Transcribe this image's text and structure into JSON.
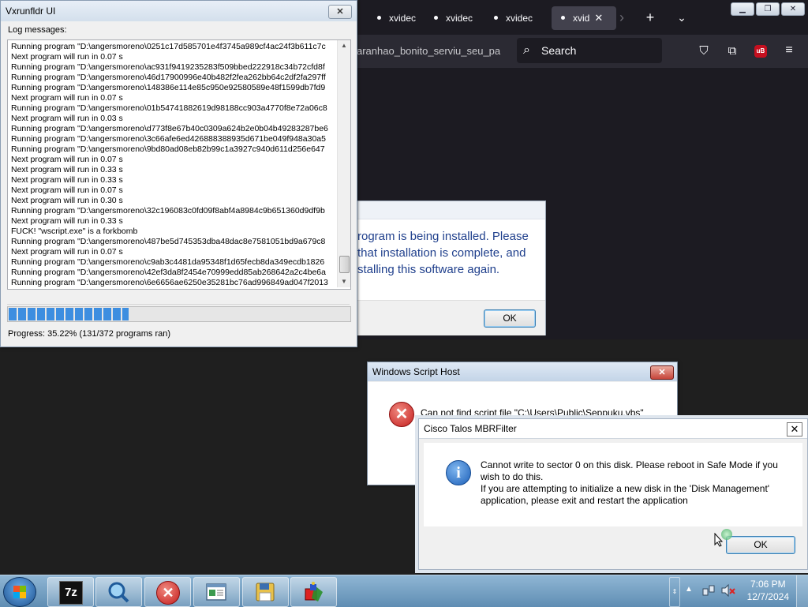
{
  "browser": {
    "tabs": [
      {
        "label": "xvidec"
      },
      {
        "label": "xvidec"
      },
      {
        "label": "xvidec"
      },
      {
        "label": "xvid"
      }
    ],
    "url_fragment": "aranhao_bonito_serviu_seu_pa",
    "search_placeholder": "Search",
    "ublock_label": "uB"
  },
  "vxrunfldr": {
    "title": "Vxrunfldr UI",
    "log_label": "Log messages:",
    "log_lines": [
      "Running program \"D:\\angersmoreno\\0251c17d585701e4f3745a989cf4ac24f3b611c7c",
      "Next program will run in 0.07 s",
      "Running program \"D:\\angersmoreno\\ac931f9419235283f509bbed222918c34b72cfd8f",
      "Running program \"D:\\angersmoreno\\46d17900996e40b482f2fea262bb64c2df2fa297ff",
      "Running program \"D:\\angersmoreno\\148386e114e85c950e92580589e48f1599db7fd9",
      "Next program will run in 0.07 s",
      "Running program \"D:\\angersmoreno\\01b54741882619d98188cc903a4770f8e72a06c8",
      "Next program will run in 0.03 s",
      "Running program \"D:\\angersmoreno\\d773f8e67b40c0309a624b2e0b04b49283287be6",
      "Running program \"D:\\angersmoreno\\3c66afe6ed426888388935d671be049f948a30a5",
      "Running program \"D:\\angersmoreno\\9bd80ad08eb82b99c1a3927c940d611d256e647",
      "Next program will run in 0.07 s",
      "Next program will run in 0.33 s",
      "Next program will run in 0.33 s",
      "Next program will run in 0.07 s",
      "Next program will run in 0.30 s",
      "Running program \"D:\\angersmoreno\\32c196083c0fd09f8abf4a8984c9b651360d9df9b",
      "Next program will run in 0.33 s",
      "FUCK! \"wscript.exe\" is a forkbomb",
      "Running program \"D:\\angersmoreno\\487be5d745353dba48dac8e7581051bd9a679c8",
      "Next program will run in 0.07 s",
      "Running program \"D:\\angersmoreno\\c9ab3c4481da95348f1d65fecb8da349ecdb1826",
      "Running program \"D:\\angersmoreno\\42ef3da8f2454e70999edd85ab268642a2c4be6a",
      "Running program \"D:\\angersmoreno\\6e6656ae6250e35281bc76ad996849ad047f2013"
    ],
    "progress_fraction": 0.3522,
    "progress_text": "Progress: 35.22% (131/372 programs ran)"
  },
  "installer_dialog": {
    "message_lines": [
      "rogram is being installed. Please",
      "that installation is complete, and",
      "stalling this software again."
    ],
    "ok_label": "OK"
  },
  "wsh_dialog": {
    "title": "Windows Script Host",
    "message": "Can not find script file \"C:\\Users\\Public\\Seppuku.vbs\"",
    "close_label": "✕"
  },
  "cisco_dialog": {
    "title": "Cisco Talos MBRFilter",
    "message_lines": [
      "Cannot write to sector 0 on this disk. Please reboot in Safe Mode if you",
      "wish to do this.",
      "If you are attempting to initialize a new disk in the 'Disk Management'",
      "application, please exit and restart the application"
    ],
    "ok_label": "OK",
    "close_label": "✕"
  },
  "taskbar": {
    "apps": [
      {
        "name": "7-zip",
        "label": "7z"
      },
      {
        "name": "magnifier",
        "label": ""
      },
      {
        "name": "error",
        "label": ""
      },
      {
        "name": "document-window",
        "label": ""
      },
      {
        "name": "floppy-save",
        "label": ""
      },
      {
        "name": "paint-shapes",
        "label": ""
      }
    ],
    "time": "7:06 PM",
    "date": "12/7/2024"
  }
}
